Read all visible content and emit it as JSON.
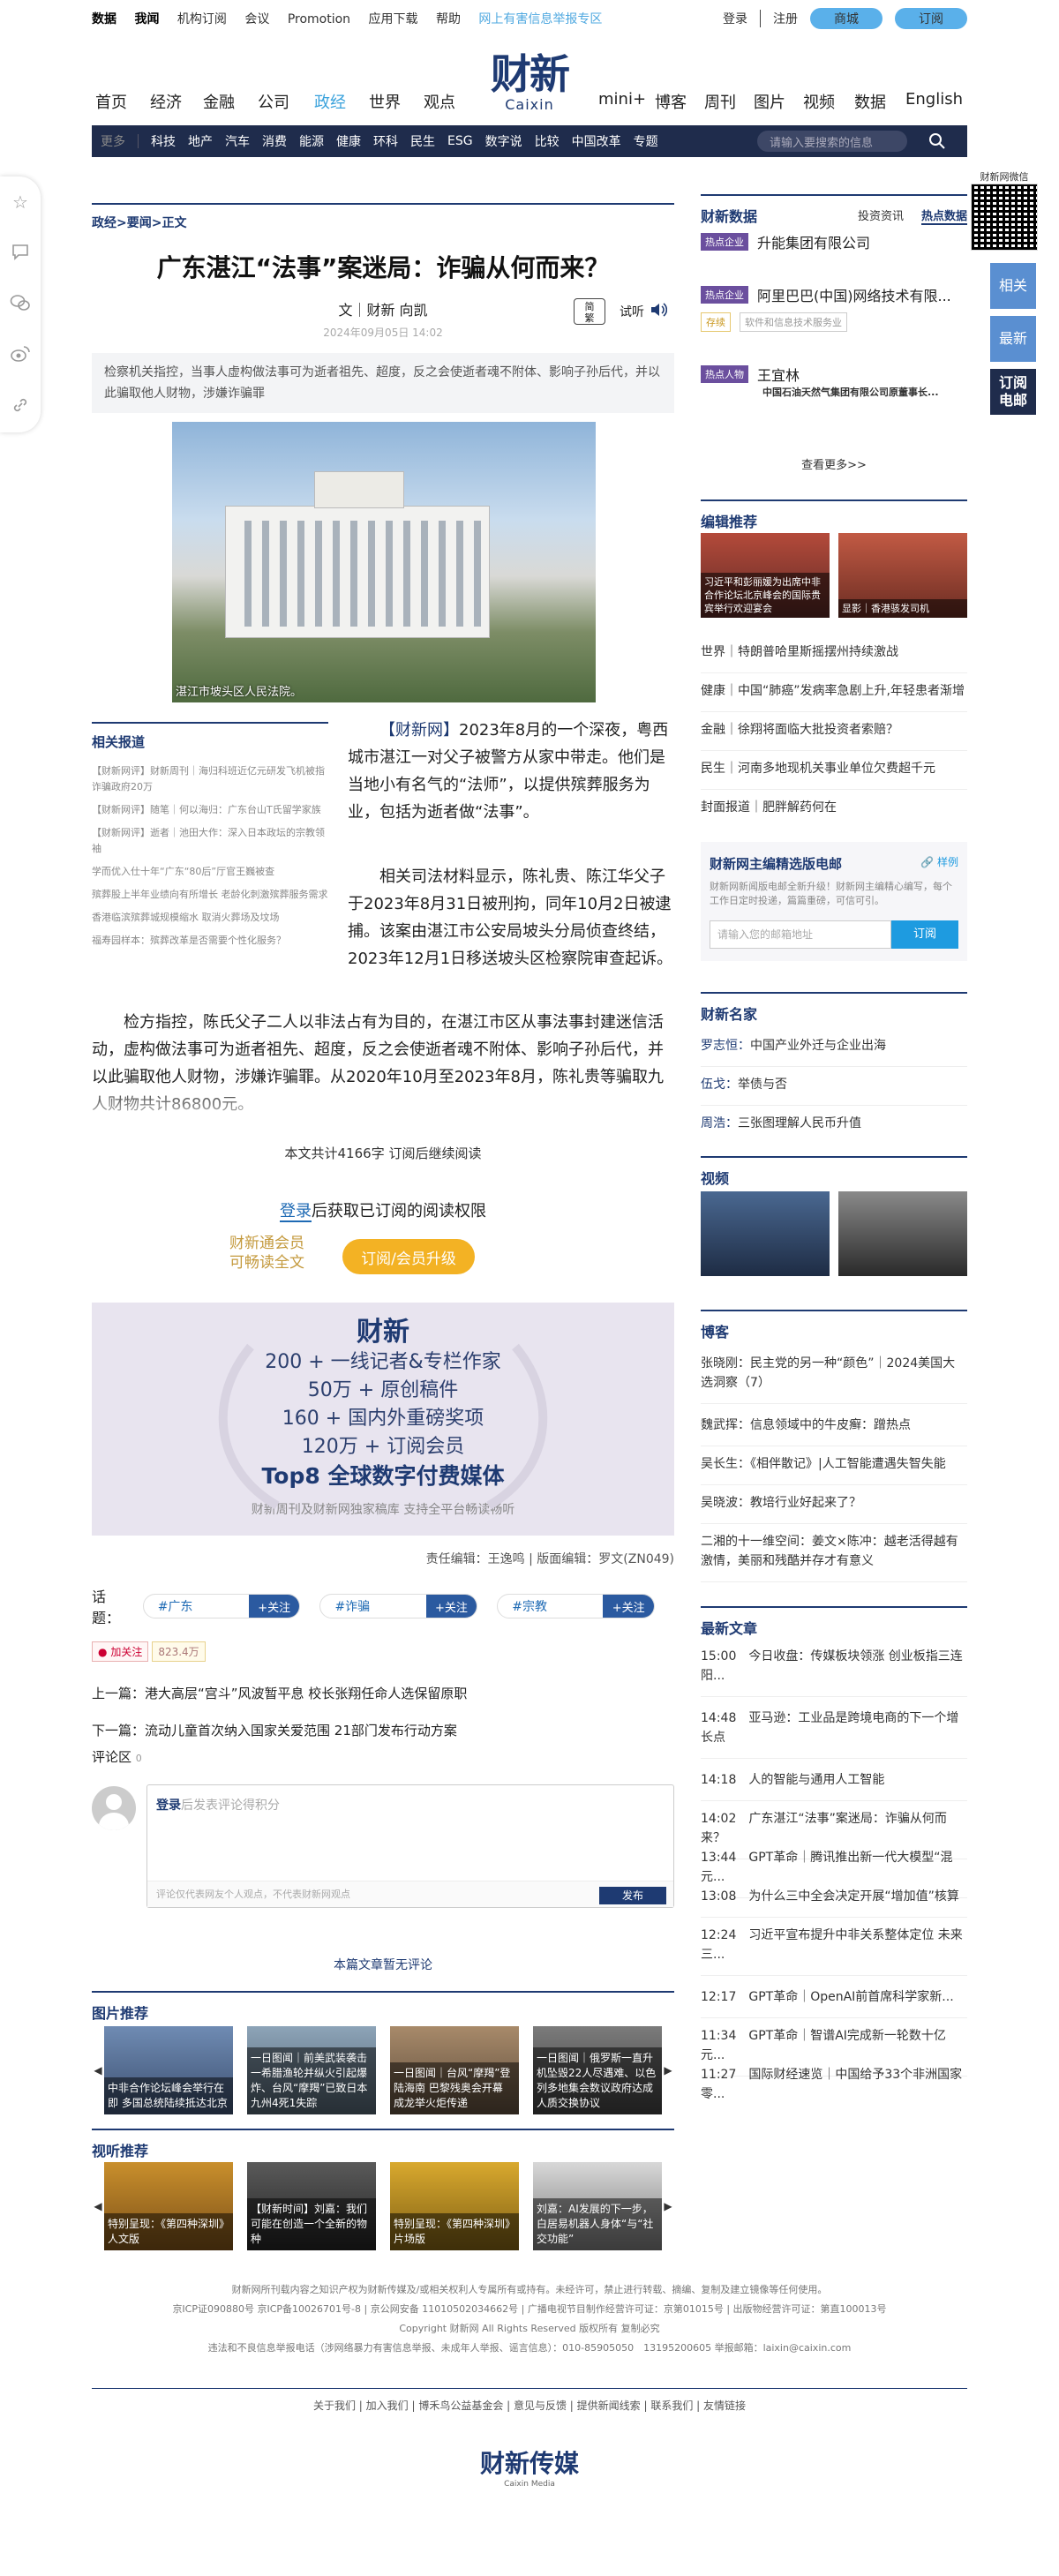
{
  "topbar": {
    "items": [
      "数据",
      "我闻",
      "机构订阅",
      "会议",
      "Promotion",
      "应用下载",
      "帮助"
    ],
    "report": "网上有害信息举报专区",
    "login": "登录",
    "register": "注册",
    "mall": "商城",
    "subscribe": "订阅"
  },
  "logo": {
    "cn": "财新",
    "en": "Caixin"
  },
  "mainnav": [
    "首页",
    "经济",
    "金融",
    "公司",
    "政经",
    "世界",
    "观点",
    "mini+",
    "博客",
    "周刊",
    "图片",
    "视频",
    "数据",
    "English"
  ],
  "subnav": {
    "more": "更多",
    "items": [
      "科技",
      "地产",
      "汽车",
      "消费",
      "能源",
      "健康",
      "环科",
      "民生",
      "ESG",
      "数字说",
      "比较",
      "中国改革",
      "专题"
    ],
    "search_placeholder": "请输入要搜索的信息"
  },
  "crumb": "政经>要闻>正文",
  "article": {
    "title": "广东湛江“法事”案迷局：诈骗从何而来？",
    "byline": "文｜财新 向凯",
    "date": "2024年09月05日 14:02",
    "fanti": "简\n繁",
    "listen": "试听",
    "summary": "检察机关指控，当事人虚构做法事可为逝者祖先、超度，反之会使逝者魂不附体、影响子孙后代，并以此骗取他人财物，涉嫌诈骗罪",
    "photo_caption": "湛江市坡头区人民法院。",
    "p1_lead": "【财新网】",
    "p1": "2023年8月的一个深夜，粤西城市湛江一对父子被警方从家中带走。他们是当地小有名气的“法师”，以提供殡葬服务为业，包括为逝者做“法事”。",
    "p2": "相关司法材料显示，陈礼贵、陈江华父子于2023年8月31日被刑拘，同年10月2日被逮捕。该案由湛江市公安局坡头分局侦查终结，2023年12月1日移送坡头区检察院审查起诉。",
    "p3": "检方指控，陈氏父子二人以非法占有为目的，在湛江市区从事法事封建迷信活动，虚构做法事可为逝者祖先、超度，反之会使逝者魂不附体、影响子孙后代，并以此骗取他人财物，涉嫌诈骗罪。从2020年10月至2023年8月，陈礼贵等骗取九人财物共计86800元。",
    "wordcount": "本文共计4166字 订阅后继续阅读",
    "login_link": "登录",
    "login_rest": "后获取已订阅的阅读权限",
    "member1": "财新通会员",
    "member2": "可畅读全文",
    "upgrade": "订阅/会员升级"
  },
  "related": {
    "title": "相关报道",
    "items": [
      "【财新网评】财新周刊｜海归科班近亿元研发飞机被指诈骗政府20万",
      "【财新网评】随笔｜何以海归：广东台山T氏留学家族",
      "【财新网评】逝者｜池田大作：深入日本政坛的宗教领袖",
      "学而优入仕十年“广东“80后”厅官王巍被查",
      "殡葬股上半年业绩向有所增长 老龄化刺激殡葬服务需求",
      "香港临滨殡葬城规模缩水 取消火葬场及坟场",
      "福寿园样本：殡葬改革是否需要个性化服务？"
    ]
  },
  "promo": {
    "logo": "财新",
    "l1": "200 + 一线记者&专栏作家",
    "l2": "50万 + 原创稿件",
    "l3": "160 + 国内外重磅奖项",
    "l4": "120万 + 订阅会员",
    "l5": "Top8 全球数字付费媒体",
    "l6": "财新周刊及财新网独家稿库 支持全平台畅读畅听"
  },
  "editors": "责任编辑：王逸鸣 | 版面编辑：罗文(ZN049)",
  "topics": {
    "label": "话题：",
    "items": [
      "#广东",
      "#诈骗",
      "#宗教"
    ],
    "follow": "+关注"
  },
  "weibo": {
    "follow": "加关注",
    "count": "823.4万"
  },
  "prev": "上一篇：港大高层“宫斗”风波暂平息 校长张翔任命人选保留原职",
  "next": "下一篇：流动儿童首次纳入国家关爱范围 21部门发布行动方案",
  "comments": {
    "label": "评论区",
    "count": "0",
    "login": "登录",
    "placeholder": "后发表评论得积分",
    "hint": "评论仅代表网友个人观点，不代表财新网观点",
    "publish": "发布",
    "none": "本篇文章暂无评论"
  },
  "photos": {
    "title": "图片推荐",
    "items": [
      "中非合作论坛峰会举行在即 多国总统陆续抵达北京",
      "一日图闻｜前美武装袭击一希腊渔轮并纵火引起爆炸、台风“摩羯”已致日本九州4死1失踪",
      "一日图闻｜台风“摩羯”登陆海南 巴黎残奥会开幕 成龙举火炬传递",
      "一日图闻｜俄罗斯一直升机坠毁22人尽遇难、以色列多地集会数议政府达成人质交换协议"
    ]
  },
  "videos": {
    "title": "视听推荐",
    "items": [
      "特别呈现：《第四种深圳》人文版",
      "【财新时间】刘嘉：我们可能在创造一个全新的物种",
      "特别呈现：《第四种深圳》片场版",
      "刘嘉：AI发展的下一步，白居易机器人身体“与“社交功能”"
    ]
  },
  "footer": {
    "l1": "财新网所刊载内容之知识产权为财新传媒及/或相关权利人专属所有或持有。未经许可，禁止进行转载、摘编、复制及建立镜像等任何使用。",
    "l2": "京ICP证090880号 京ICP备10026701号-8 | 京公网安备 11010502034662号 | 广播电视节目制作经营许可证：京第01015号 | 出版物经营许可证：第直100013号",
    "l3": "Copyright 财新网 All Rights Reserved 版权所有 复制必究",
    "l4": "违法和不良信息举报电话（涉网络暴力有害信息举报、未成年人举报、谣言信息）：010-85905050　13195200605 举报邮箱：laixin@caixin.com",
    "links": "关于我们 | 加入我们 | 博禾鸟公益基金会 | 意见与反馈 | 提供新闻线索 | 联系我们 | 友情链接",
    "logo_cn": "财新传媒",
    "logo_en": "Caixin Media"
  },
  "right": {
    "qr_label": "财新网微信",
    "side": [
      "相关",
      "最新",
      "订阅\n电邮"
    ],
    "data_title": "财新数据",
    "data_tabs": [
      "投资资讯",
      "热点数据"
    ],
    "hot_tag": "热点企业",
    "hot_person": "热点人物",
    "hot1": "升能集团有限公司",
    "hot2": "阿里巴巴(中国)网络技术有限...",
    "t_oa": "存续",
    "t_ob": "软件和信息技术服务业",
    "hot3": "王宜林",
    "hot3_sub": "中国石油天然气集团有限公司原董事长...",
    "more": "查看更多>>",
    "edrec_title": "编辑推荐",
    "edrec_pics": [
      "习近平和彭丽媛为出席中非合作论坛北京峰会的国际贵宾举行欢迎宴会",
      "显影｜香港骇发司机"
    ],
    "edrec_items": [
      "世界｜特朗普哈里斯摇摆州持续激战",
      "健康｜中国“肺癌”发病率急剧上升,年轻患者渐增",
      "金融｜徐翔将面临大批投资者索赔？",
      "民生｜河南多地现机关事业单位欠费超千元",
      "封面报道｜肥胖解药何在"
    ],
    "mail": {
      "title": "财新网主编精选版电邮",
      "sample": "样例",
      "desc": "财新网新闻版电邮全新升级！财新网主编精心编写，每个工作日定时投递，篇篇重磅，可信可引。",
      "placeholder": "请输入您的邮箱地址",
      "btn": "订阅"
    },
    "names_title": "财新名家",
    "names": [
      [
        "罗志恒：",
        "中国产业外迁与企业出海"
      ],
      [
        "伍戈：",
        "举债与否"
      ],
      [
        "周浩：",
        "三张图理解人民币升值"
      ]
    ],
    "video_title": "视频",
    "video_caps": [
      "",
      ""
    ],
    "blog_title": "博客",
    "blogs": [
      "张晓刚：民主党的另一种“颜色”｜2024美国大选洞察（7）",
      "魏武挥：信息领域中的牛皮癣：蹭热点",
      "吴长生：《相伴散记》|人工智能遭遇失智失能",
      "吴晓波：教培行业好起来了？",
      "二湘的十一维空间：姜文×陈冲：越老活得越有激情，美丽和残酷并存才有意义"
    ],
    "latest_title": "最新文章",
    "latest": [
      [
        "15:00",
        "今日收盘：传媒板块领涨 创业板指三连阳..."
      ],
      [
        "14:48",
        "亚马逊：工业品是跨境电商的下一个增长点"
      ],
      [
        "14:18",
        "人的智能与通用人工智能"
      ],
      [
        "14:02",
        "广东湛江“法事”案迷局：诈骗从何而来？"
      ],
      [
        "13:44",
        "GPT革命｜腾讯推出新一代大模型“混元..."
      ],
      [
        "13:08",
        "为什么三中全会决定开展“增加值”核算"
      ],
      [
        "12:24",
        "习近平宣布提升中非关系整体定位 未来三..."
      ],
      [
        "12:17",
        "GPT革命｜OpenAI前首席科学家新..."
      ],
      [
        "11:34",
        "GPT革命｜智谱AI完成新一轮数十亿元..."
      ],
      [
        "11:27",
        "国际财经速览｜中国给予33个非洲国家零..."
      ]
    ]
  }
}
